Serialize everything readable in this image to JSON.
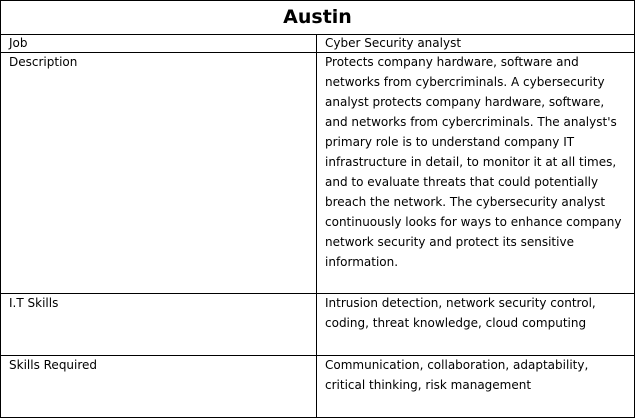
{
  "title": "Austin",
  "rows": [
    {
      "label": "Job",
      "value": "Cyber Security analyst"
    },
    {
      "label": "Description",
      "value": "Protects company hardware, software and networks from cybercriminals. A cybersecurity analyst protects company hardware, software, and networks from cybercriminals. The analyst's primary role is to understand company IT infrastructure in detail, to monitor it at all times, and to evaluate threats that could potentially breach the network. The cybersecurity analyst continuously looks for ways to enhance company network security and protect its sensitive information."
    },
    {
      "label": "I.T Skills",
      "value": "Intrusion detection, network security control, coding, threat knowledge, cloud computing"
    },
    {
      "label": "Skills Required",
      "value": "Communication, collaboration, adaptability, critical thinking, risk management"
    }
  ]
}
